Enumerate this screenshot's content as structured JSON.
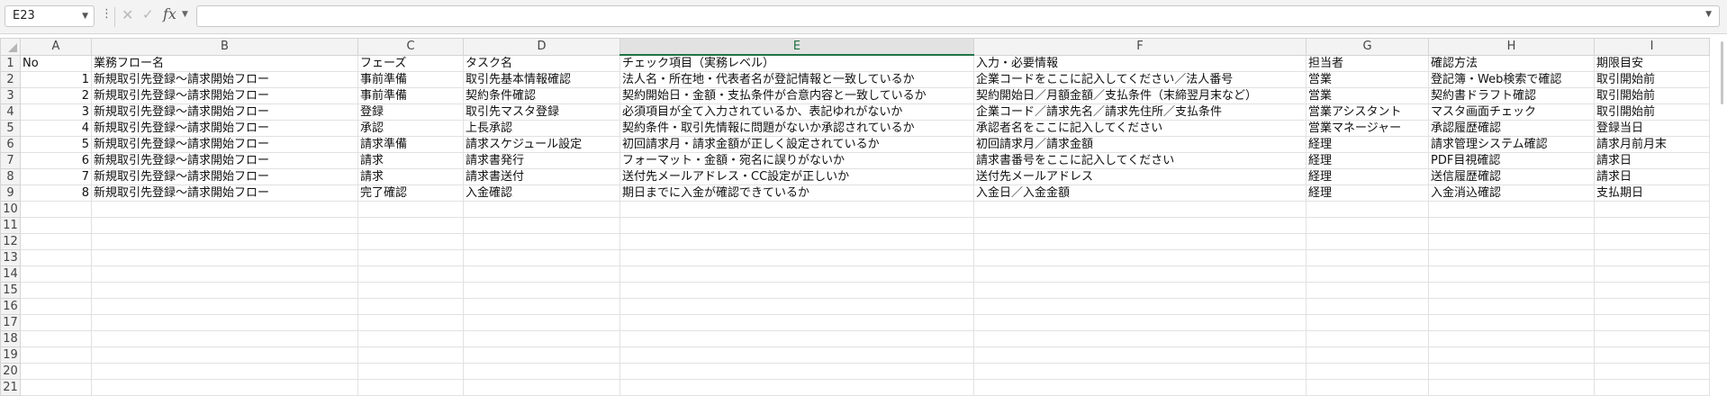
{
  "formula_bar": {
    "name_box": "E23",
    "formula": ""
  },
  "columns": [
    "A",
    "B",
    "C",
    "D",
    "E",
    "F",
    "G",
    "H",
    "I"
  ],
  "active_column": "E",
  "row_numbers": [
    "1",
    "2",
    "3",
    "4",
    "5",
    "6",
    "7",
    "8",
    "9",
    "10",
    "11",
    "12",
    "13",
    "14",
    "15",
    "16",
    "17",
    "18",
    "19",
    "20",
    "21"
  ],
  "active_row": "23",
  "header_row": [
    "No",
    "業務フロー名",
    "フェーズ",
    "タスク名",
    "チェック項目（実務レベル）",
    "入力・必要情報",
    "担当者",
    "確認方法",
    "期限目安"
  ],
  "rows": [
    [
      "1",
      "新規取引先登録～請求開始フロー",
      "事前準備",
      "取引先基本情報確認",
      "法人名・所在地・代表者名が登記情報と一致しているか",
      "企業コードをここに記入してください／法人番号",
      "営業",
      "登記簿・Web検索で確認",
      "取引開始前"
    ],
    [
      "2",
      "新規取引先登録～請求開始フロー",
      "事前準備",
      "契約条件確認",
      "契約開始日・金額・支払条件が合意内容と一致しているか",
      "契約開始日／月額金額／支払条件（末締翌月末など）",
      "営業",
      "契約書ドラフト確認",
      "取引開始前"
    ],
    [
      "3",
      "新規取引先登録～請求開始フロー",
      "登録",
      "取引先マスタ登録",
      "必須項目が全て入力されているか、表記ゆれがないか",
      "企業コード／請求先名／請求先住所／支払条件",
      "営業アシスタント",
      "マスタ画面チェック",
      "取引開始前"
    ],
    [
      "4",
      "新規取引先登録～請求開始フロー",
      "承認",
      "上長承認",
      "契約条件・取引先情報に問題がないか承認されているか",
      "承認者名をここに記入してください",
      "営業マネージャー",
      "承認履歴確認",
      "登録当日"
    ],
    [
      "5",
      "新規取引先登録～請求開始フロー",
      "請求準備",
      "請求スケジュール設定",
      "初回請求月・請求金額が正しく設定されているか",
      "初回請求月／請求金額",
      "経理",
      "請求管理システム確認",
      "請求月前月末"
    ],
    [
      "6",
      "新規取引先登録～請求開始フロー",
      "請求",
      "請求書発行",
      "フォーマット・金額・宛名に誤りがないか",
      "請求書番号をここに記入してください",
      "経理",
      "PDF目視確認",
      "請求日"
    ],
    [
      "7",
      "新規取引先登録～請求開始フロー",
      "請求",
      "請求書送付",
      "送付先メールアドレス・CC設定が正しいか",
      "送付先メールアドレス",
      "経理",
      "送信履歴確認",
      "請求日"
    ],
    [
      "8",
      "新規取引先登録～請求開始フロー",
      "完了確認",
      "入金確認",
      "期日までに入金が確認できているか",
      "入金日／入金金額",
      "経理",
      "入金消込確認",
      "支払期日"
    ]
  ]
}
